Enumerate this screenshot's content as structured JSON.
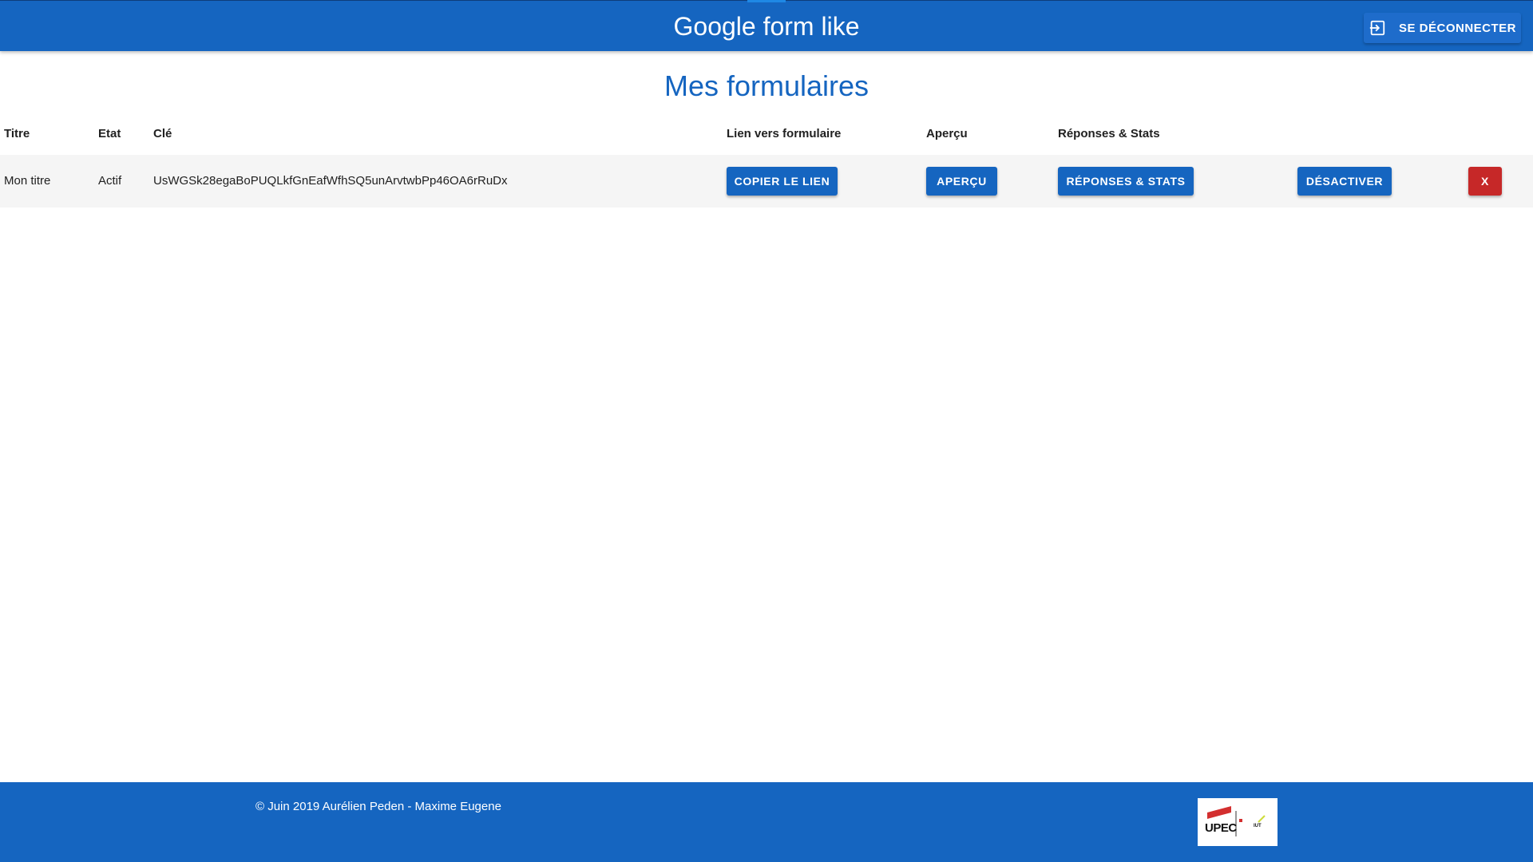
{
  "header": {
    "title": "Google form like",
    "logout_label": "SE DÉCONNECTER",
    "logout_icon": "logout-icon"
  },
  "main": {
    "title": "Mes formulaires",
    "columns": [
      "Titre",
      "Etat",
      "Clé",
      "Lien vers formulaire",
      "Aperçu",
      "Réponses & Stats"
    ],
    "rows": [
      {
        "titre": "Mon titre",
        "etat": "Actif",
        "cle": "UsWGSk28egaBoPUQLkfGnEafWfhSQ5unArvtwbPp46OA6rRuDx",
        "copy_label": "COPIER LE LIEN",
        "preview_label": "APERÇU",
        "stats_label": "RÉPONSES & STATS",
        "deactivate_label": "DÉSACTIVER",
        "delete_label": "X"
      }
    ]
  },
  "footer": {
    "text": "© Juin 2019 Aurélien Peden - Maxime Eugene",
    "logo_text": "UPEC",
    "logo_sub": "IUT"
  },
  "colors": {
    "primary": "#1565c0",
    "danger": "#c62828",
    "row_background": "#f5f5f5"
  }
}
